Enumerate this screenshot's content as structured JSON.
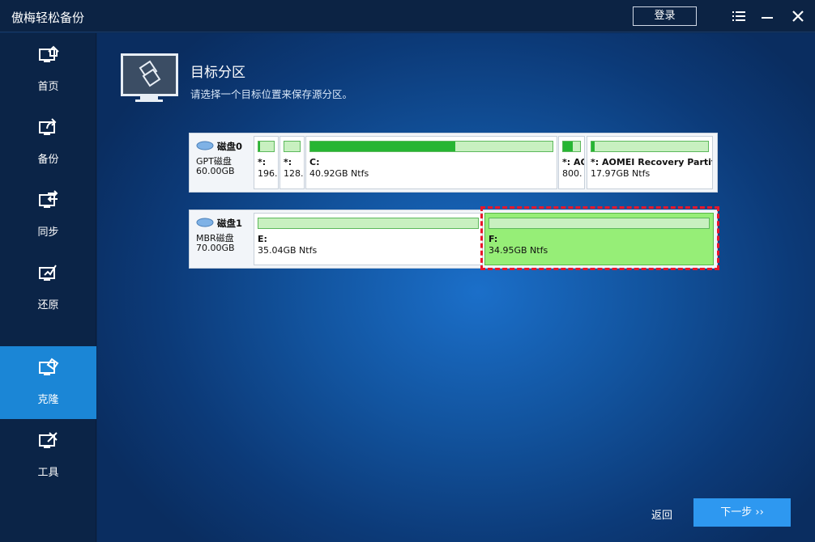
{
  "app": {
    "title": "傲梅轻松备份",
    "login_label": "登录"
  },
  "sidebar": {
    "items": [
      {
        "label": "首页",
        "icon": "home-icon"
      },
      {
        "label": "备份",
        "icon": "backup-icon"
      },
      {
        "label": "同步",
        "icon": "sync-icon"
      },
      {
        "label": "还原",
        "icon": "restore-icon"
      },
      {
        "label": "克隆",
        "icon": "clone-icon",
        "active": true
      },
      {
        "label": "工具",
        "icon": "tools-icon"
      }
    ]
  },
  "page": {
    "title": "目标分区",
    "subtitle": "请选择一个目标位置来保存源分区。"
  },
  "disks": [
    {
      "name": "磁盘0",
      "type": "GPT磁盘",
      "size": "60.00GB",
      "partitions": [
        {
          "name": "*:",
          "info": "196.",
          "used": 0.1
        },
        {
          "name": "*:",
          "info": "128.",
          "used": 0.0
        },
        {
          "name": "C:",
          "info": "40.92GB Ntfs",
          "used": 0.6
        },
        {
          "name": "*: AO",
          "info": "800.",
          "used": 0.55
        },
        {
          "name": "*: AOMEI Recovery Partit",
          "info": "17.97GB Ntfs",
          "used": 0.03
        }
      ]
    },
    {
      "name": "磁盘1",
      "type": "MBR磁盘",
      "size": "70.00GB",
      "partitions": [
        {
          "name": "E:",
          "info": "35.04GB Ntfs",
          "used": 0.0
        },
        {
          "name": "F:",
          "info": "34.95GB Ntfs",
          "used": 0.0,
          "selected": true
        }
      ]
    }
  ],
  "footer": {
    "back_label": "返回",
    "next_label": "下一步 ››"
  },
  "colors": {
    "active_nav": "#1b86d6",
    "next_button": "#2e98f0",
    "selection_border": "#e8162a",
    "selected_partition": "#96ee77",
    "usage_fill": "#27b533"
  }
}
